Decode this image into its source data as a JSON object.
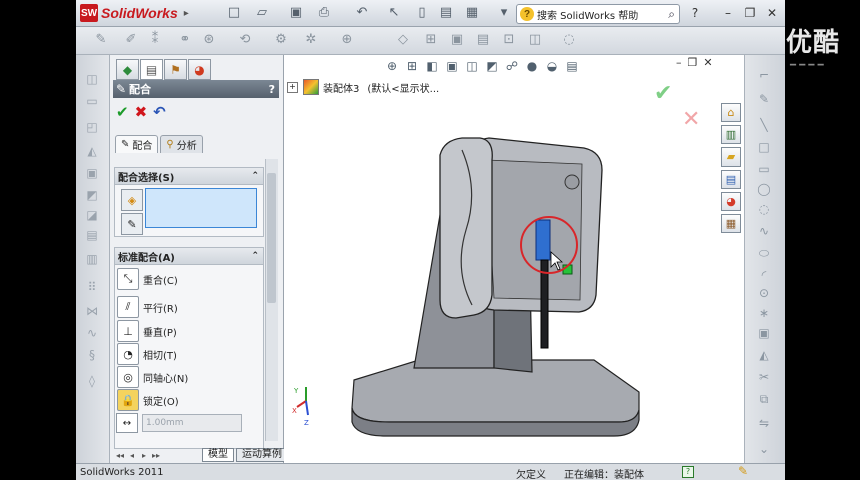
{
  "app": {
    "name": "SolidWorks",
    "logo_text": "SW"
  },
  "help_search": {
    "placeholder": "搜索 SolidWorks 帮助"
  },
  "property_manager": {
    "title": "配合",
    "help": "?",
    "tabs": {
      "mates": "配合",
      "analysis": "分析"
    },
    "selection_group": {
      "title": "配合选择(S)"
    },
    "standard_group": {
      "title": "标准配合(A)"
    },
    "mates": [
      {
        "label": "重合(C)",
        "icon": "coincident-icon"
      },
      {
        "label": "平行(R)",
        "icon": "parallel-icon"
      },
      {
        "label": "垂直(P)",
        "icon": "perpendicular-icon"
      },
      {
        "label": "相切(T)",
        "icon": "tangent-icon"
      },
      {
        "label": "同轴心(N)",
        "icon": "concentric-icon"
      },
      {
        "label": "锁定(O)",
        "icon": "lock-icon"
      }
    ],
    "distance_value": "1.00mm"
  },
  "graphics": {
    "tree_root": "装配体3",
    "tree_config": "(默认<显示状..."
  },
  "bottom_tabs": [
    "模型",
    "运动算例 1"
  ],
  "status": {
    "app": "SolidWorks 2011",
    "underdefined": "欠定义",
    "editing": "正在编辑：装配体",
    "help": "?"
  },
  "watermark": "优酷",
  "colors": {
    "accent": "#3b86d6",
    "ok": "#1c9b2a",
    "cancel": "#d0161c",
    "brand": "#c8191e",
    "highlight": "#2f6fd0",
    "selection_ring": "#d8262a"
  }
}
